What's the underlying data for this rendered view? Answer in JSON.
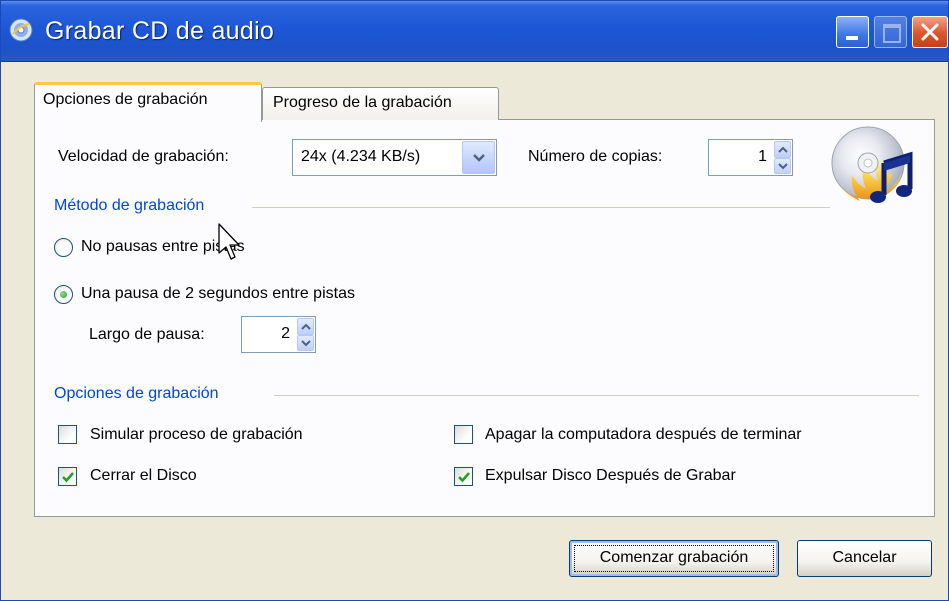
{
  "window": {
    "title": "Grabar CD de audio",
    "title_icon": "disc-burn-icon"
  },
  "tabs": [
    {
      "label": "Opciones de grabación",
      "active": true
    },
    {
      "label": "Progreso de la grabación",
      "active": false
    }
  ],
  "speed": {
    "label": "Velocidad de grabación:",
    "value": "24x (4.234 KB/s)"
  },
  "copies": {
    "label": "Número de copias:",
    "value": "1"
  },
  "method": {
    "title": "Método de grabación",
    "options": [
      {
        "label": "No pausas entre pistas",
        "selected": false
      },
      {
        "label": "Una pausa de 2 segundos entre pistas",
        "selected": true
      }
    ],
    "pause_label": "Largo de pausa:",
    "pause_value": "2"
  },
  "options": {
    "title": "Opciones de grabación",
    "checkboxes": [
      {
        "label": "Simular proceso de grabación",
        "checked": false
      },
      {
        "label": "Apagar la computadora después de terminar",
        "checked": false
      },
      {
        "label": "Cerrar el Disco",
        "checked": true
      },
      {
        "label": "Expulsar Disco Después de Grabar",
        "checked": true
      }
    ]
  },
  "buttons": {
    "start": "Comenzar grabación",
    "cancel": "Cancelar"
  },
  "colors": {
    "titlebar": "#1c56d6",
    "group_title": "#0046d5",
    "active_tab_accent": "#ffc83c",
    "dialog_bg": "#ece9d8"
  }
}
